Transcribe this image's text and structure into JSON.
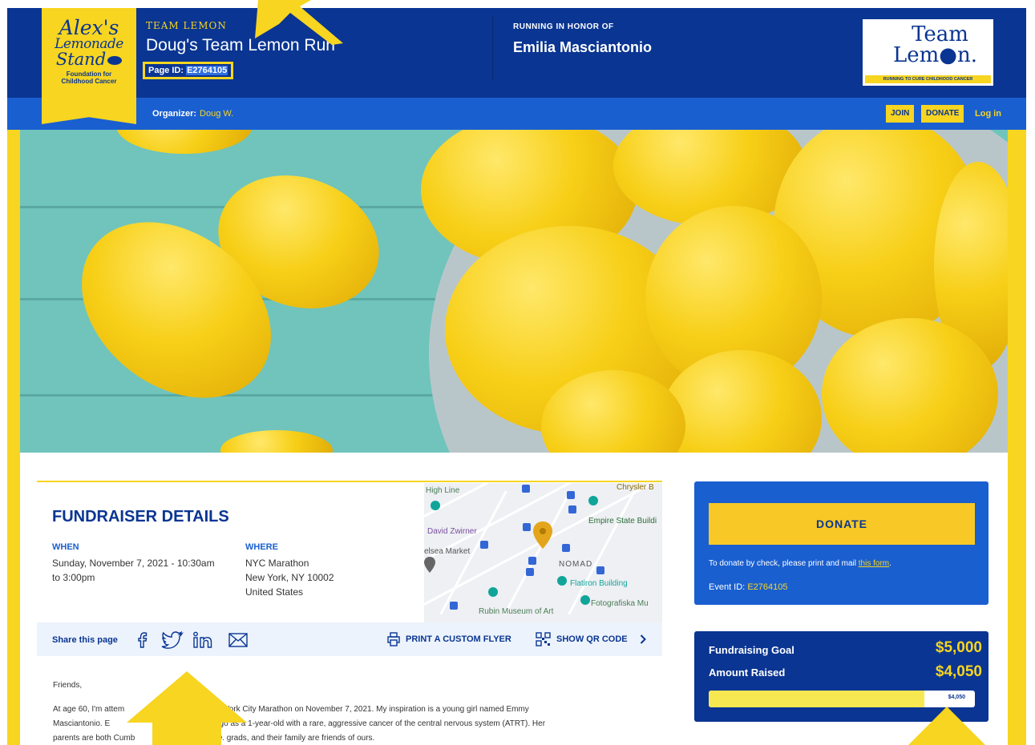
{
  "colors": {
    "navy": "#0a3592",
    "blue": "#1a5fd0",
    "yellow": "#f7d520",
    "donate_yellow": "#f7c826"
  },
  "logo": {
    "line1": "Alex's",
    "line2": "Lemonade",
    "line3": "Stand",
    "tagline1": "Foundation for",
    "tagline2": "Childhood Cancer"
  },
  "header": {
    "team_label": "TEAM LEMON",
    "page_title": "Doug's Team Lemon Run",
    "page_id_label": "Page ID:",
    "page_id_value": "E2764105",
    "honor_label": "RUNNING IN HONOR OF",
    "honor_name": "Emilia Masciantonio"
  },
  "team_lemon_logo": {
    "line1": "Team",
    "line2": "Lem●n.",
    "banner": "RUNNING TO CURE CHILDHOOD CANCER"
  },
  "subnav": {
    "organizer_label": "Organizer:",
    "organizer_name": "Doug W.",
    "join": "JOIN",
    "donate": "DONATE",
    "login": "Log in"
  },
  "details": {
    "title": "FUNDRAISER DETAILS",
    "when_label": "WHEN",
    "when_value_1": "Sunday, November 7, 2021 - 10:30am",
    "when_value_2": "to 3:00pm",
    "where_label": "WHERE",
    "where_value_1": "NYC Marathon",
    "where_value_2": "New York, NY 10002",
    "where_value_3": "United States"
  },
  "map": {
    "labels": [
      "High Line",
      "Chrysler B",
      "Empire State Buildi",
      "David Zwirner",
      "elsea Market",
      "NOMAD",
      "Flatiron Building",
      "Fotografiska Mu",
      "Rubin Museum of Art"
    ]
  },
  "share": {
    "label": "Share this page",
    "icons": [
      "facebook-icon",
      "twitter-icon",
      "linkedin-icon",
      "email-icon"
    ],
    "print_flyer": "PRINT A CUSTOM FLYER",
    "qr_code": "SHOW QR CODE"
  },
  "story": {
    "greeting": "Friends,",
    "line1": "At age 60, I'm attem",
    "line1b": "York City Marathon on November 7, 2021.  My inspiration is a young girl named Emmy",
    "line2": "Masciantonio.  E",
    "line2b": "ago as a 1-year-old with a rare, aggressive cancer of the central nervous system (ATRT).  Her",
    "line3": "parents are both Cumb",
    "line3b": "D. grads, and their family are friends of ours."
  },
  "donate_box": {
    "button": "DONATE",
    "check_text": "To donate by check, please print and mail",
    "check_link": "this form",
    "check_end": ".",
    "event_id_label": "Event ID:",
    "event_id_value": "E2764105"
  },
  "goal_box": {
    "goal_label": "Fundraising Goal",
    "goal_value": "$5,000",
    "raised_label": "Amount Raised",
    "raised_value": "$4,050",
    "progress_label": "$4,050",
    "progress_fraction": 0.81
  }
}
